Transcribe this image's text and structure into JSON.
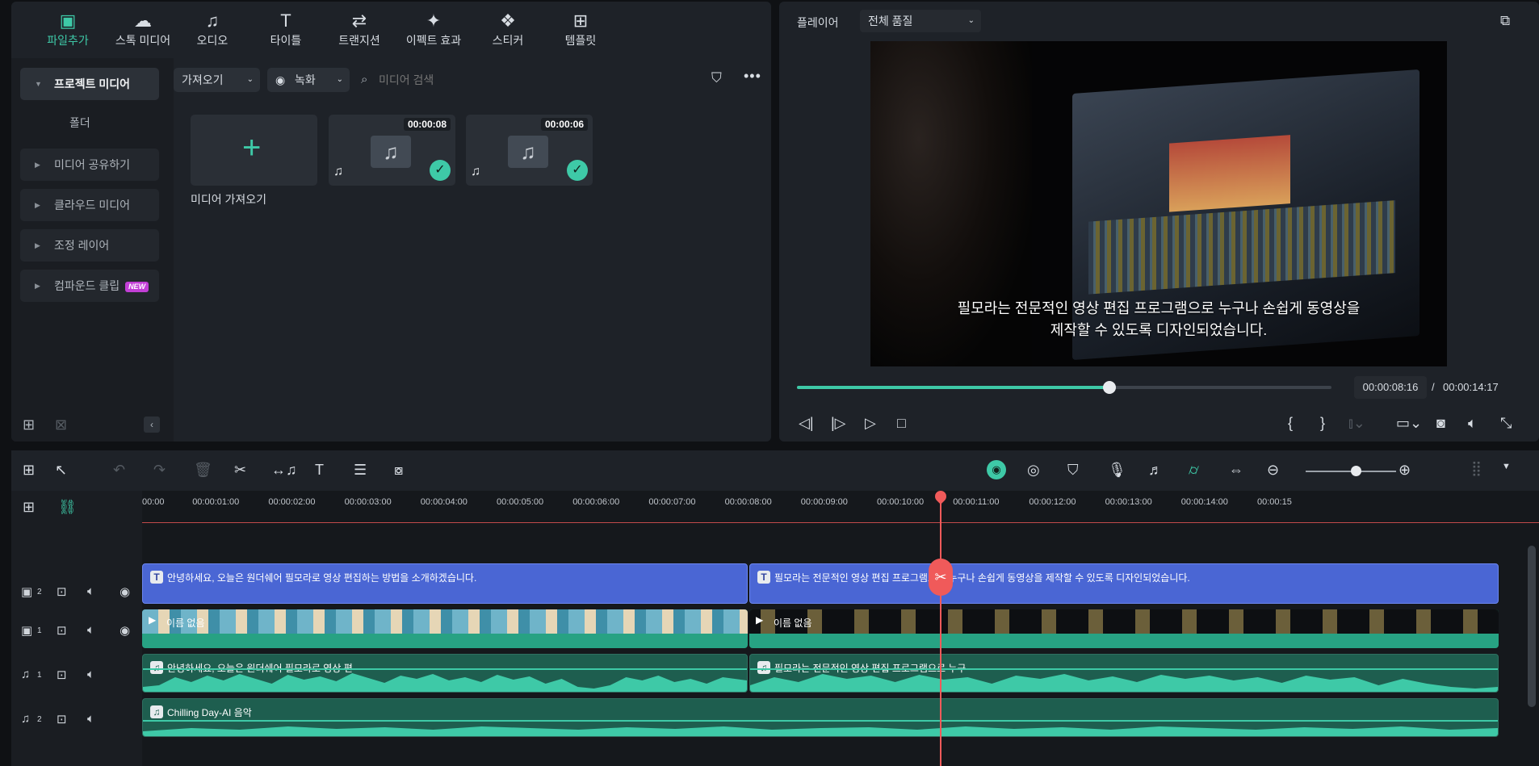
{
  "media": {
    "tabs": [
      {
        "label": "파일추가",
        "icon": "import-media-icon"
      },
      {
        "label": "스톡 미디어",
        "icon": "stock-media-icon"
      },
      {
        "label": "오디오",
        "icon": "music-note-icon"
      },
      {
        "label": "타이틀",
        "icon": "title-text-icon"
      },
      {
        "label": "트랜지션",
        "icon": "transition-icon"
      },
      {
        "label": "이펙트 효과",
        "icon": "effects-sparkle-icon"
      },
      {
        "label": "스티커",
        "icon": "sticker-icon"
      },
      {
        "label": "템플릿",
        "icon": "template-grid-icon"
      }
    ],
    "sidebar": {
      "project_media": "프로젝트 미디어",
      "folder": "폴더",
      "items": [
        "미디어 공유하기",
        "클라우드 미디어",
        "조정 레이어",
        "컴파운드 클립"
      ],
      "new_badge": "NEW"
    },
    "toolbar": {
      "import_dropdown": "가져오기",
      "record_dropdown": "녹화",
      "search_placeholder": "미디어 검색"
    },
    "import_tile_label": "미디어 가져오기",
    "items": [
      {
        "duration": "00:00:08"
      },
      {
        "duration": "00:00:06"
      }
    ]
  },
  "player": {
    "label": "플레이어",
    "quality": "전체 품질",
    "subtitle_line1": "필모라는 전문적인 영상 편집 프로그램으로 누구나 손쉽게 동영상을",
    "subtitle_line2": "제작할 수 있도록 디자인되었습니다.",
    "current_time": "00:00:08:16",
    "separator": "/",
    "total_time": "00:00:14:17",
    "progress": 0.585,
    "accent": "#3ec9a7"
  },
  "timeline": {
    "ruler_labels": [
      "00:00",
      "00:00:01:00",
      "00:00:02:00",
      "00:00:03:00",
      "00:00:04:00",
      "00:00:05:00",
      "00:00:06:00",
      "00:00:07:00",
      "00:00:08:00",
      "00:00:09:00",
      "00:00:10:00",
      "00:00:11:00",
      "00:00:12:00",
      "00:00:13:00",
      "00:00:14:00",
      "00:00:15"
    ],
    "tracks": [
      {
        "num": "2"
      },
      {
        "num": "1"
      },
      {
        "num": "1"
      },
      {
        "num": "2"
      }
    ],
    "title_clips": [
      "안녕하세요, 오늘은 원더쉐어 필모라로 영상 편집하는 방법을 소개하겠습니다.",
      "필모라는 전문적인 영상 편집 프로그램으로 누구나 손쉽게 동영상을 제작할 수 있도록 디자인되었습니다."
    ],
    "video_clips": [
      "이름 없음",
      "이름 없음"
    ],
    "audio_clips": [
      "안녕하세요, 오늘은 원더쉐어 필모라로 영상 편",
      "필모라는 전문적인 영상 편집 프로그램으로 누구"
    ],
    "music_clip": "Chilling Day-AI 음악"
  }
}
